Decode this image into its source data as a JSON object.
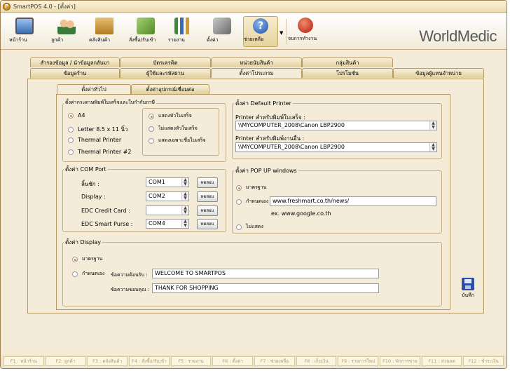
{
  "window": {
    "title": "SmartPOS 4.0 - [ตั้งค่า]"
  },
  "brand": "WorldMedic",
  "toolbar": [
    {
      "label": "หน้าร้าน",
      "icon": "monitor-icon",
      "color": "#5a8ac6"
    },
    {
      "label": "ลูกค้า",
      "icon": "customers-icon",
      "color": "#3a7a3a"
    },
    {
      "label": "คลังสินค้า",
      "icon": "inventory-icon",
      "color": "#c8902a"
    },
    {
      "label": "สั่งซื้อ/รับเข้า",
      "icon": "purchase-icon",
      "color": "#6a9a3a"
    },
    {
      "label": "รายงาน",
      "icon": "report-chart-icon",
      "color": "#3a7ab0"
    },
    {
      "label": "ตั้งค่า",
      "icon": "settings-tools-icon",
      "color": "#7a6a5a"
    },
    {
      "label": "ช่วยเหลือ",
      "icon": "help-icon",
      "color": "#2a5ab0"
    },
    {
      "label": "จบการทำงาน",
      "icon": "exit-icon",
      "color": "#c03020"
    }
  ],
  "tabs_row1": [
    "สำรองข้อมูล / นำข้อมูลกลับมา",
    "บัตรเครดิต",
    "หน่วยนับสินค้า",
    "กลุ่มสินค้า"
  ],
  "tabs_row2": [
    "ข้อมูลร้าน",
    "ผู้ใช้และรหัสผ่าน",
    "ตั้งค่าโปรแกรม",
    "โปรโมชั่น",
    "ข้อมูลผู้แทนจำหน่าย"
  ],
  "subtabs": [
    "ตั้งค่าทั่วไป",
    "ตั้งค่าอุปกรณ์เชื่อมต่อ"
  ],
  "paper": {
    "title": "ตั้งค่ากระดาษพิมพ์ใบเสร็จและใบกำกับภาษี",
    "sizes": [
      "A4",
      "Letter 8.5 x 11 นิ้ว",
      "Thermal Printer",
      "Thermal Printer #2"
    ],
    "header_options": [
      "แสดงหัวใบเสร็จ",
      "ไม่แสดงหัวใบเสร็จ",
      "แสดงเฉพาะชื่อใบเสร็จ"
    ]
  },
  "printer": {
    "title": "ตั้งค่า Default Printer",
    "receipt_label": "Printer สำหรับพิมพ์ใบเสร็จ :",
    "receipt_value": "\\\\MYCOMPUTER_2008\\Canon LBP2900",
    "other_label": "Printer สำหรับพิมพ์งานอื่น :",
    "other_value": "\\\\MYCOMPUTER_2008\\Canon LBP2900"
  },
  "com": {
    "title": "ตั้งค่า COM Port",
    "rows": [
      {
        "label": "ลิ้นชัก :",
        "value": "COM1",
        "button": "ทดสอบ"
      },
      {
        "label": "Display :",
        "value": "COM2",
        "button": "ทดสอบ"
      },
      {
        "label": "EDC Credit Card :",
        "value": "",
        "button": "ทดสอบ"
      },
      {
        "label": "EDC Smart Purse :",
        "value": "COM4",
        "button": "ทดสอบ"
      }
    ]
  },
  "popup": {
    "title": "ตั้งค่า POP UP windows",
    "standard": "มาตรฐาน",
    "custom": "กำหนดเอง",
    "url": "www.freshmart.co.th/news/",
    "example": "ex.   www.google.co.th",
    "none": "ไม่แสดง"
  },
  "display": {
    "title": "ตั้งค่า Display",
    "standard": "มาตรฐาน",
    "custom": "กำหนดเอง",
    "welcome_label": "ข้อความต้อนรับ :",
    "welcome_value": "WELCOME TO SMARTPOS",
    "thanks_label": "ข้อความขอบคุณ :",
    "thanks_value": "THANK FOR SHOPPING"
  },
  "save_label": "บันทึก",
  "fkeys": [
    "F1 : หน้าร้าน",
    "F2: ลูกค้า",
    "F3 : คลังสินค้า",
    "F4 : สั่งซื้อ/รับเข้า",
    "F5 : รายงาน",
    "F6 : ตั้งค่า",
    "F7 : ช่วยเหลือ",
    "F8 : เก็บเงิน",
    "F9 : รายการใหม่",
    "F10 : พักการขาย",
    "F11 : ส่วนลด",
    "F12 : ชำระเงิน"
  ]
}
